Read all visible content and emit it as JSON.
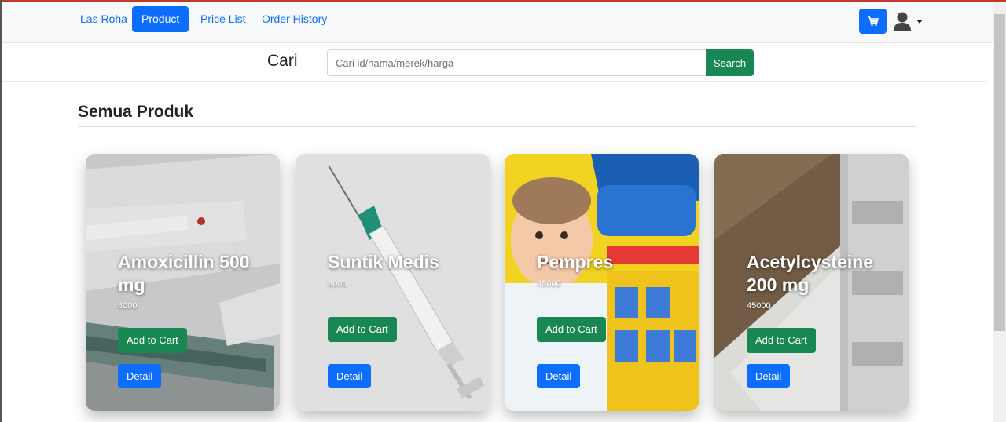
{
  "navbar": {
    "brand": "Las Roha",
    "links": [
      {
        "label": "Product",
        "active": true
      },
      {
        "label": "Price List",
        "active": false
      },
      {
        "label": "Order History",
        "active": false
      }
    ],
    "cart_icon": "cart-icon",
    "user_icon": "user-icon"
  },
  "search": {
    "label": "Cari",
    "placeholder": "Cari id/nama/merek/harga",
    "value": "",
    "button": "Search"
  },
  "section": {
    "title": "Semua Produk"
  },
  "products": [
    {
      "name": "Amoxicillin 500 mg",
      "price": "8000",
      "add_label": "Add to Cart",
      "detail_label": "Detail",
      "image": "amoxicillin-package"
    },
    {
      "name": "Suntik Medis",
      "price": "3000",
      "add_label": "Add to Cart",
      "detail_label": "Detail",
      "image": "syringe"
    },
    {
      "name": "Pempres",
      "price": "45000",
      "add_label": "Add to Cart",
      "detail_label": "Detail",
      "image": "diaper-package"
    },
    {
      "name": "Acetylcysteine 200 mg",
      "price": "45000",
      "add_label": "Add to Cart",
      "detail_label": "Detail",
      "image": "acetylcysteine-blister"
    }
  ],
  "colors": {
    "primary": "#0d6efd",
    "success": "#198754",
    "navbar_bg": "#f8f9fa"
  }
}
